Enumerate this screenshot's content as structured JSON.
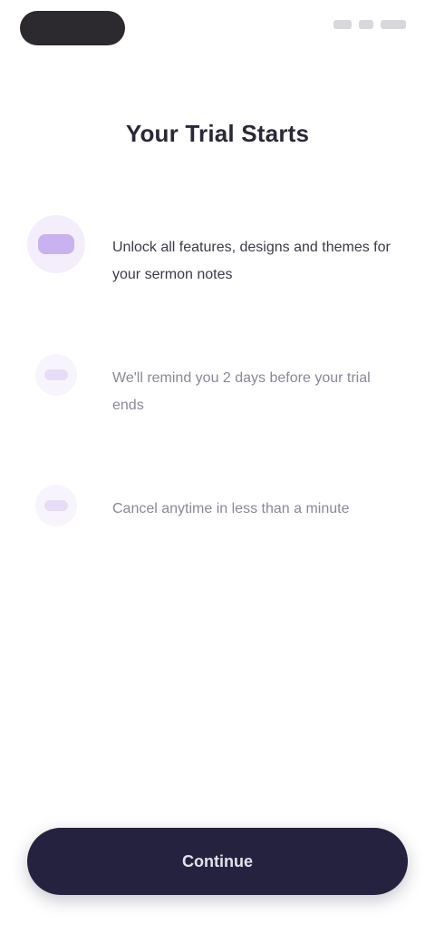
{
  "header": {
    "title": "Your Trial Starts"
  },
  "steps": [
    {
      "icon": "sparkle-icon",
      "text": "Unlock all features, designs and themes for your sermon notes"
    },
    {
      "icon": "bell-icon",
      "text": "We'll remind you 2 days before your trial ends"
    },
    {
      "icon": "crown-icon",
      "text": "Cancel anytime in less than a minute"
    }
  ],
  "actions": {
    "continue_label": "Continue"
  },
  "colors": {
    "accent": "#c9b2ef",
    "button": "#25223f",
    "title": "#2a2838"
  }
}
